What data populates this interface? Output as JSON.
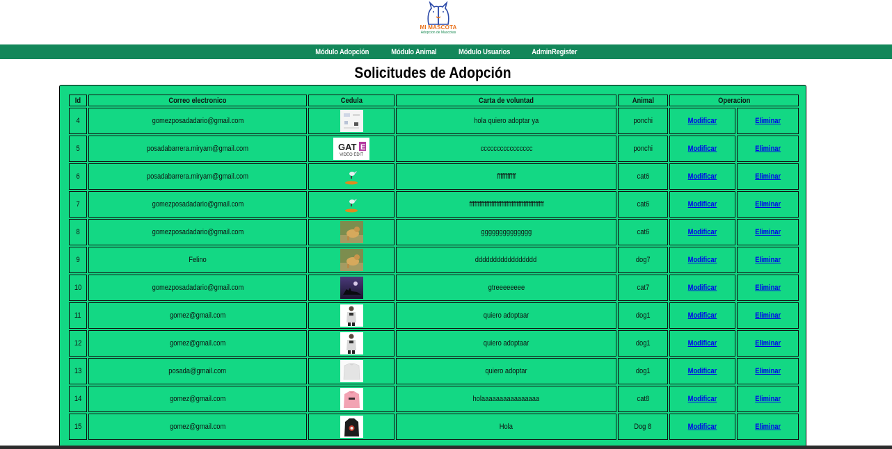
{
  "header": {
    "logo_title": "MI MASCOTA",
    "logo_subtitle": "Adopcion de Mascotas"
  },
  "nav": {
    "items": [
      "Módulo Adopción",
      "Módulo Animal",
      "Módulo Usuarios",
      "AdminRegister"
    ]
  },
  "page": {
    "title": "Solicitudes de Adopción"
  },
  "table": {
    "columns": [
      "Id",
      "Correo electronico",
      "Cedula",
      "Carta de voluntad",
      "Animal",
      "Operacion"
    ],
    "modify_label": "Modificar",
    "delete_label": "Eliminar",
    "rows": [
      {
        "id": "4",
        "email": "gomezposadadario@gmail.com",
        "letter": "hola quiero adoptar ya",
        "animal": "ponchi",
        "thumb": "document-thumb"
      },
      {
        "id": "5",
        "email": "posadabarrera.miryam@gmail.com",
        "letter": "cccccccccccccccc",
        "animal": "ponchi",
        "thumb": "gate-logo-thumb",
        "thumb_text": "GATE",
        "thumb_subtext": "VIDEO EDIT"
      },
      {
        "id": "6",
        "email": "posadabarrera.miryam@gmail.com",
        "letter": "fffffffffff",
        "animal": "cat6",
        "thumb": "bird-thumb"
      },
      {
        "id": "7",
        "email": "gomezposadadario@gmail.com",
        "letter": "ffffffffffffffffffffffffffffffffffffffffffff",
        "animal": "cat6",
        "thumb": "bird-thumb"
      },
      {
        "id": "8",
        "email": "gomezposadadario@gmail.com",
        "letter": "gggggggggggggg",
        "animal": "cat6",
        "thumb": "dog-photo-thumb"
      },
      {
        "id": "9",
        "email": "Felino",
        "letter": "ddddddddddddddddd",
        "animal": "dog7",
        "thumb": "dog-photo-thumb"
      },
      {
        "id": "10",
        "email": "gomezposadadario@gmail.com",
        "letter": "gtreeeeeeee",
        "animal": "cat7",
        "thumb": "wolf-silhouette-thumb"
      },
      {
        "id": "11",
        "email": "gomez@gmail.com",
        "letter": "quiero adoptaar",
        "animal": "dog1",
        "thumb": "hoodie-person-thumb"
      },
      {
        "id": "12",
        "email": "gomez@gmail.com",
        "letter": "quiero adoptaar",
        "animal": "dog1",
        "thumb": "hoodie-person-thumb"
      },
      {
        "id": "13",
        "email": "posada@gmail.com",
        "letter": "quiero adoptar",
        "animal": "dog1",
        "thumb": "white-hoodie-thumb"
      },
      {
        "id": "14",
        "email": "gomez@gmail.com",
        "letter": "holaaaaaaaaaaaaaaaa",
        "animal": "cat8",
        "thumb": "pink-hoodie-thumb"
      },
      {
        "id": "15",
        "email": "gomez@gmail.com",
        "letter": "Hola",
        "animal": "Dog 8",
        "thumb": "black-hoodie-thumb"
      }
    ]
  },
  "colors": {
    "navbar": "#13875a",
    "table_bg": "#13d884",
    "link": "#0000ee",
    "logo_orange": "#e8731e",
    "logo_blue": "#2c4aa8"
  }
}
